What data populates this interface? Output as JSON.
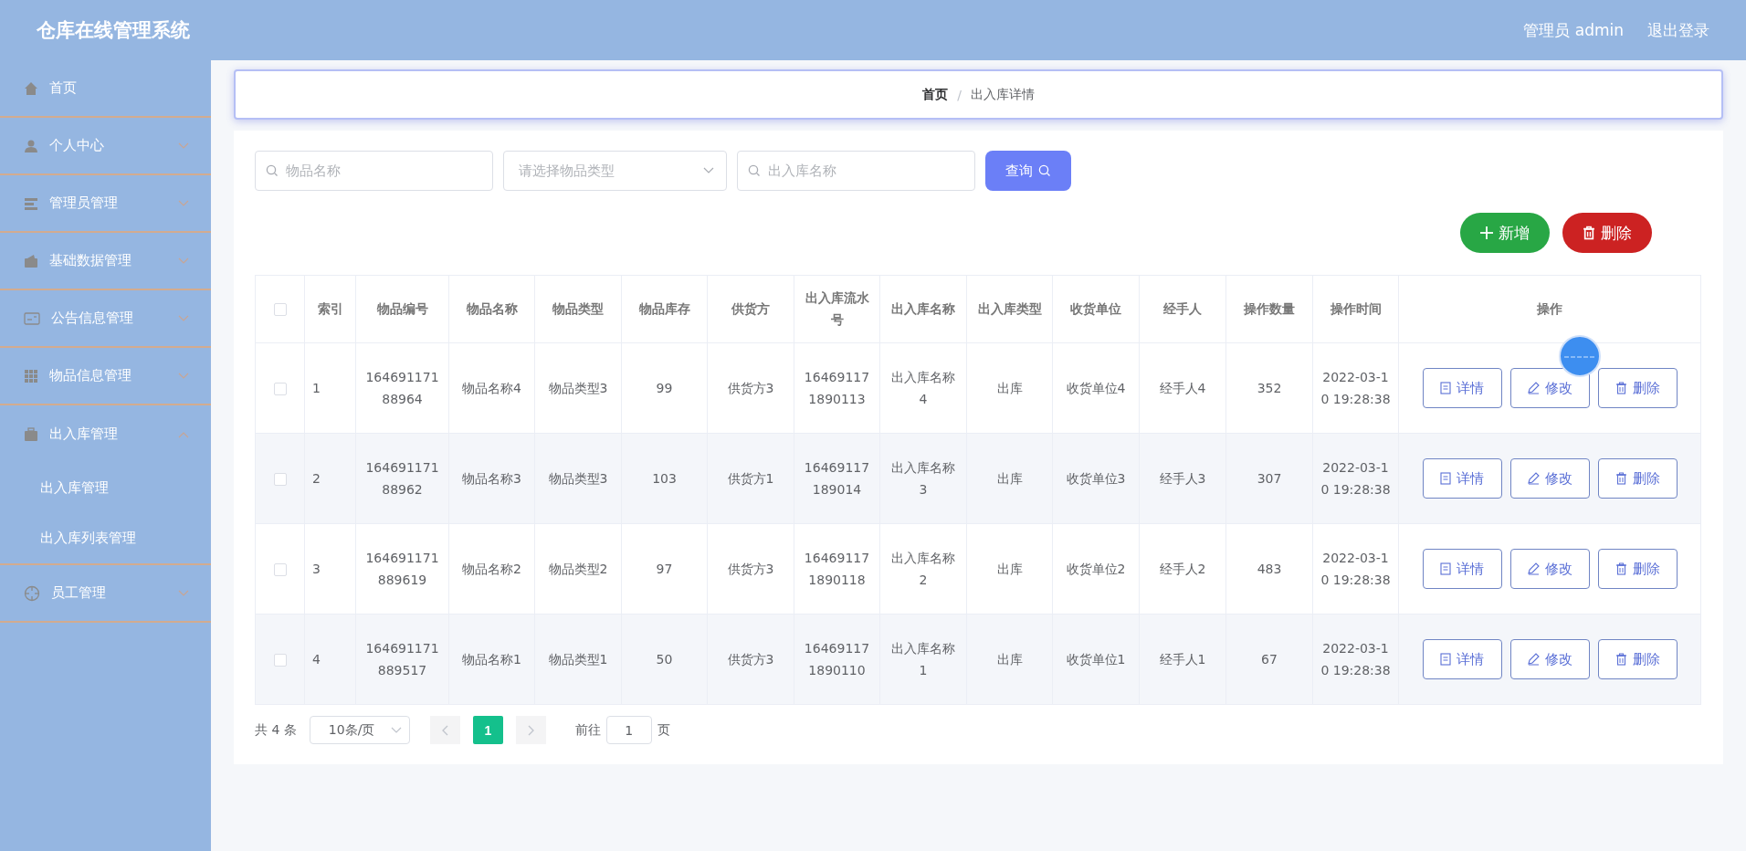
{
  "header": {
    "title": "仓库在线管理系统",
    "user": "管理员 admin",
    "logout": "退出登录"
  },
  "sidebar": {
    "items": [
      {
        "label": "首页",
        "kind": "link"
      },
      {
        "label": "个人中心",
        "kind": "submenu",
        "expanded": false
      },
      {
        "label": "管理员管理",
        "kind": "submenu",
        "expanded": false
      },
      {
        "label": "基础数据管理",
        "kind": "submenu",
        "expanded": false
      },
      {
        "label": "公告信息管理",
        "kind": "submenu",
        "expanded": false
      },
      {
        "label": "物品信息管理",
        "kind": "submenu",
        "expanded": false
      },
      {
        "label": "出入库管理",
        "kind": "submenu",
        "expanded": true,
        "children": [
          {
            "label": "出入库管理"
          },
          {
            "label": "出入库列表管理"
          }
        ]
      },
      {
        "label": "员工管理",
        "kind": "submenu",
        "expanded": false
      }
    ]
  },
  "breadcrumb": {
    "items": [
      "首页",
      "出入库详情"
    ],
    "separator": "/"
  },
  "filters": {
    "name": {
      "placeholder": "物品名称"
    },
    "type": {
      "placeholder": "请选择物品类型"
    },
    "inout": {
      "placeholder": "出入库名称"
    },
    "search_button": "查询"
  },
  "actions": {
    "add": "新增",
    "delete": "删除"
  },
  "table": {
    "select_all_checked": false,
    "columns": [
      "索引",
      "物品编号",
      "物品名称",
      "物品类型",
      "物品库存",
      "供货方",
      "出入库流水号",
      "出入库名称",
      "出入库类型",
      "收货单位",
      "经手人",
      "操作数量",
      "操作时间",
      "操作"
    ],
    "rows": [
      {
        "checked": false,
        "cells": [
          "1",
          "16469117188964",
          "物品名称4",
          "物品类型3",
          "99",
          "供货方3",
          "164691171890113",
          "出入库名称4",
          "出库",
          "收货单位4",
          "经手人4",
          "352",
          "2022-03-10 19:28:38"
        ],
        "actions": [
          "详情",
          "修改",
          "删除"
        ]
      },
      {
        "checked": false,
        "cells": [
          "2",
          "16469117188962",
          "物品名称3",
          "物品类型3",
          "103",
          "供货方1",
          "16469117189014",
          "出入库名称3",
          "出库",
          "收货单位3",
          "经手人3",
          "307",
          "2022-03-10 19:28:38"
        ],
        "actions": [
          "详情",
          "修改",
          "删除"
        ]
      },
      {
        "checked": false,
        "cells": [
          "3",
          "164691171889619",
          "物品名称2",
          "物品类型2",
          "97",
          "供货方3",
          "164691171890118",
          "出入库名称2",
          "出库",
          "收货单位2",
          "经手人2",
          "483",
          "2022-03-10 19:28:38"
        ],
        "actions": [
          "详情",
          "修改",
          "删除"
        ]
      },
      {
        "checked": false,
        "cells": [
          "4",
          "164691171889517",
          "物品名称1",
          "物品类型1",
          "50",
          "供货方3",
          "164691171890110",
          "出入库名称1",
          "出库",
          "收货单位1",
          "经手人1",
          "67",
          "2022-03-10 19:28:38"
        ],
        "actions": [
          "详情",
          "修改",
          "删除"
        ]
      }
    ]
  },
  "pagination": {
    "total": "共 4 条",
    "page_size": "10条/页",
    "pages": [
      {
        "label": "1",
        "selected": true
      }
    ],
    "goto_label": "前往",
    "goto_value": "1",
    "goto_suffix": "页"
  }
}
